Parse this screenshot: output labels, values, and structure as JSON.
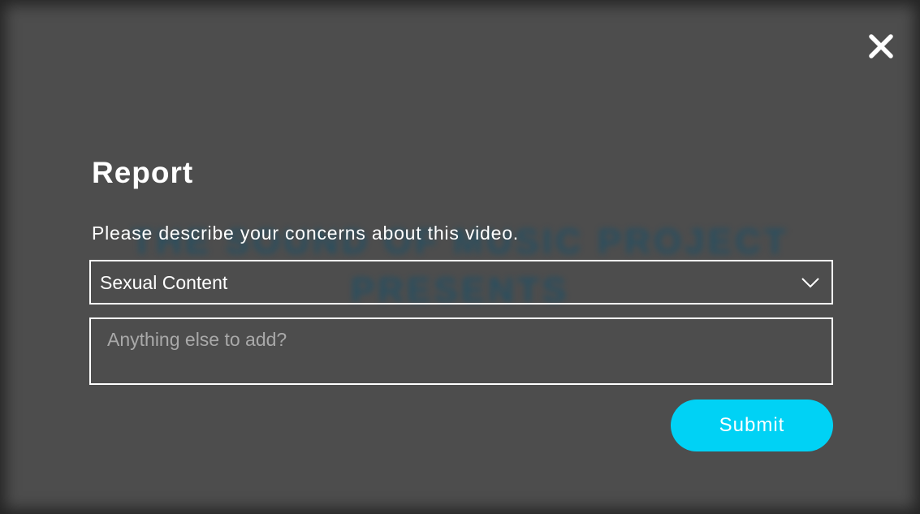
{
  "background": {
    "video_title_line1": "The Sound of Music Project",
    "video_title_line2": "Presents"
  },
  "close": {
    "icon": "close-icon"
  },
  "modal": {
    "title": "Report",
    "description": "Please describe your concerns about this video.",
    "reason_select": {
      "selected_value": "Sexual Content",
      "icon": "chevron-down-icon"
    },
    "details_field": {
      "value": "",
      "placeholder": "Anything else to add?"
    },
    "submit_label": "Submit"
  },
  "colors": {
    "overlay": "#4d4d4d",
    "text": "#ffffff",
    "accent": "#00d2f5",
    "placeholder": "#a9a9a9"
  }
}
